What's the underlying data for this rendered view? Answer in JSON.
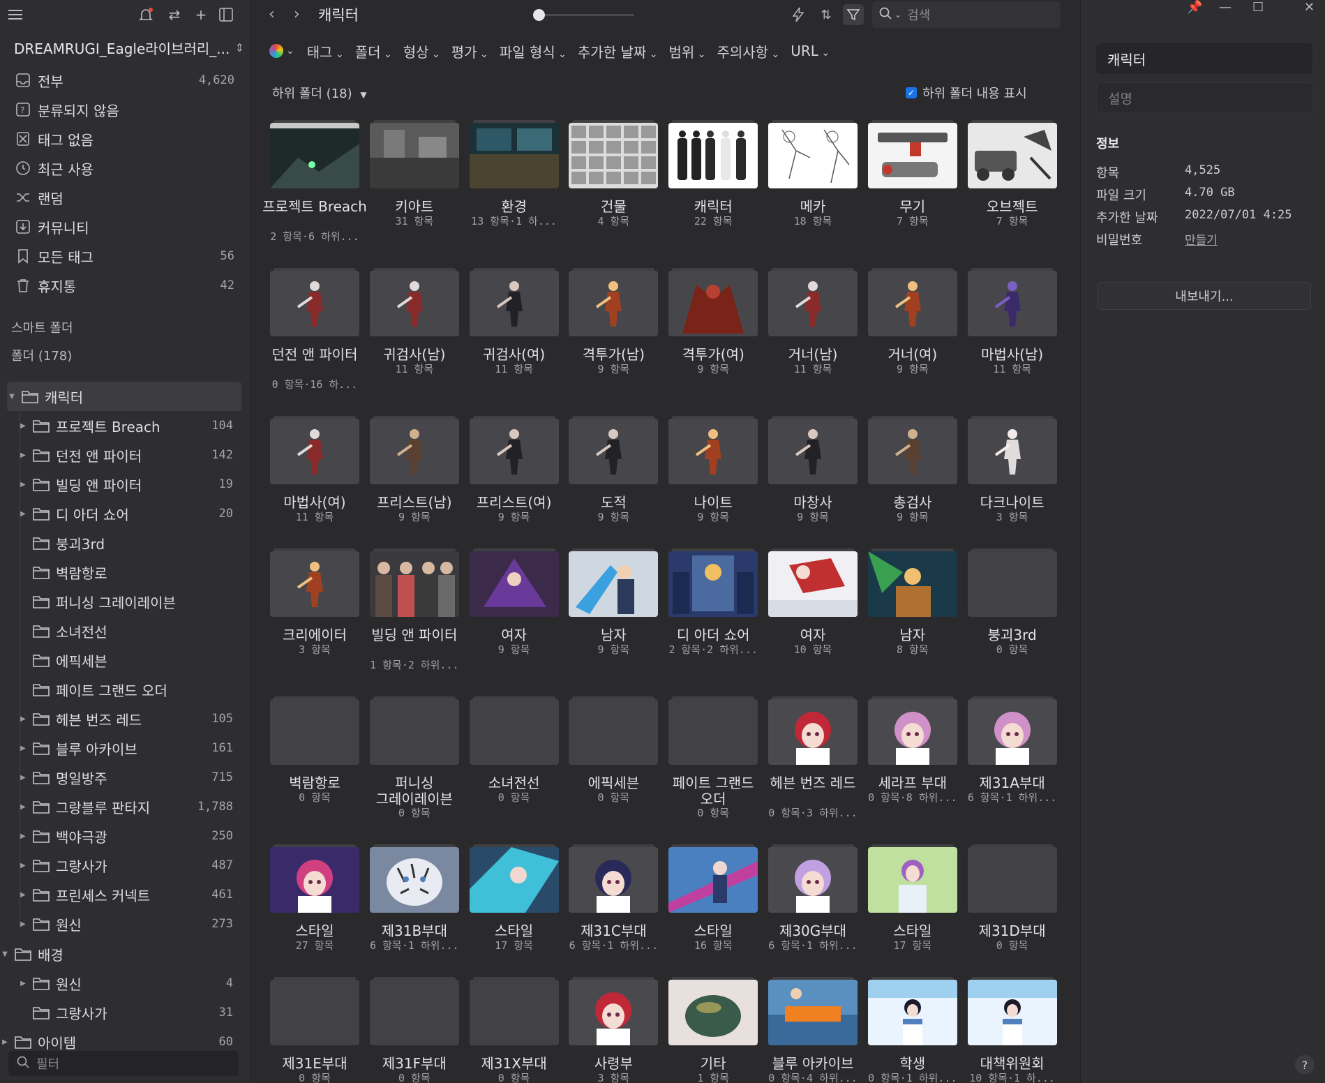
{
  "library": {
    "name": "DREAMRUGI_Eagle라이브러리_..."
  },
  "nav": [
    {
      "label": "전부",
      "count": "4,620",
      "icon": "inbox-icon"
    },
    {
      "label": "분류되지 않음",
      "count": "",
      "icon": "unsorted-icon"
    },
    {
      "label": "태그 없음",
      "count": "",
      "icon": "untagged-icon"
    },
    {
      "label": "최근 사용",
      "count": "",
      "icon": "clock-icon"
    },
    {
      "label": "랜덤",
      "count": "",
      "icon": "shuffle-icon"
    },
    {
      "label": "커뮤니티",
      "count": "",
      "icon": "download-icon"
    },
    {
      "label": "모든 태그",
      "count": "56",
      "icon": "bookmark-icon"
    },
    {
      "label": "휴지통",
      "count": "42",
      "icon": "trash-icon"
    }
  ],
  "sections": {
    "smart": "스마트 폴더",
    "folders": "폴더 (178)"
  },
  "tree": [
    {
      "label": "캐릭터",
      "count": "",
      "level": 0,
      "caret": "down",
      "selected": true
    },
    {
      "label": "프로젝트 Breach",
      "count": "104",
      "level": 1,
      "caret": "right"
    },
    {
      "label": "던전 앤 파이터",
      "count": "142",
      "level": 1,
      "caret": "right"
    },
    {
      "label": "빌딩 앤 파이터",
      "count": "19",
      "level": 1,
      "caret": "right"
    },
    {
      "label": "디 아더 쇼어",
      "count": "20",
      "level": 1,
      "caret": "right"
    },
    {
      "label": "붕괴3rd",
      "count": "",
      "level": 1,
      "caret": ""
    },
    {
      "label": "벽람항로",
      "count": "",
      "level": 1,
      "caret": ""
    },
    {
      "label": "퍼니싱 그레이레이븐",
      "count": "",
      "level": 1,
      "caret": ""
    },
    {
      "label": "소녀전선",
      "count": "",
      "level": 1,
      "caret": ""
    },
    {
      "label": "에픽세븐",
      "count": "",
      "level": 1,
      "caret": ""
    },
    {
      "label": "페이트 그랜드 오더",
      "count": "",
      "level": 1,
      "caret": ""
    },
    {
      "label": "헤븐 번즈 레드",
      "count": "105",
      "level": 1,
      "caret": "right"
    },
    {
      "label": "블루 아카이브",
      "count": "161",
      "level": 1,
      "caret": "right"
    },
    {
      "label": "명일방주",
      "count": "715",
      "level": 1,
      "caret": "right"
    },
    {
      "label": "그랑블루 판타지",
      "count": "1,788",
      "level": 1,
      "caret": "right"
    },
    {
      "label": "백야극광",
      "count": "250",
      "level": 1,
      "caret": "right"
    },
    {
      "label": "그랑사가",
      "count": "487",
      "level": 1,
      "caret": "right"
    },
    {
      "label": "프린세스 커넥트",
      "count": "461",
      "level": 1,
      "caret": "right"
    },
    {
      "label": "원신",
      "count": "273",
      "level": 1,
      "caret": "right"
    },
    {
      "label": "배경",
      "count": "",
      "level": 0,
      "caret": "down"
    },
    {
      "label": "원신",
      "count": "4",
      "level": 1,
      "caret": "right"
    },
    {
      "label": "그랑사가",
      "count": "31",
      "level": 1,
      "caret": ""
    },
    {
      "label": "아이템",
      "count": "60",
      "level": 0,
      "caret": "right"
    }
  ],
  "filter_placeholder": "필터",
  "topbar": {
    "title": "캐릭터",
    "search_placeholder": "검색"
  },
  "filters": [
    "태그",
    "폴더",
    "형상",
    "평가",
    "파일 형식",
    "추가한 날짜",
    "범위",
    "주의사항",
    "URL"
  ],
  "subfolders": {
    "label": "하위 폴더 (18)",
    "show_label": "하위 폴더 내용 표시"
  },
  "cards": [
    {
      "name": "프로젝트 Breach",
      "meta": "2 항목·6 하위...",
      "thumb": "screen"
    },
    {
      "name": "키아트",
      "meta": "31 항목",
      "thumb": "gray"
    },
    {
      "name": "환경",
      "meta": "13 항목·1 하...",
      "thumb": "teal"
    },
    {
      "name": "건물",
      "meta": "4 항목",
      "thumb": "sketch"
    },
    {
      "name": "캐릭터",
      "meta": "22 항목",
      "thumb": "white-chars"
    },
    {
      "name": "메카",
      "meta": "18 항목",
      "thumb": "lineart"
    },
    {
      "name": "무기",
      "meta": "7 항목",
      "thumb": "weapon"
    },
    {
      "name": "오브젝트",
      "meta": "7 항목",
      "thumb": "objects"
    },
    {
      "name": "던전 앤 파이터",
      "meta": "0 항목·16 하...",
      "thumb": "char-red"
    },
    {
      "name": "귀검사(남)",
      "meta": "11 항목",
      "thumb": "char-red"
    },
    {
      "name": "귀검사(여)",
      "meta": "11 항목",
      "thumb": "char-dark"
    },
    {
      "name": "격투가(남)",
      "meta": "9 항목",
      "thumb": "char-orange"
    },
    {
      "name": "격투가(여)",
      "meta": "9 항목",
      "thumb": "char-crimson"
    },
    {
      "name": "거너(남)",
      "meta": "11 항목",
      "thumb": "char-red"
    },
    {
      "name": "거너(여)",
      "meta": "9 항목",
      "thumb": "char-orange"
    },
    {
      "name": "마법사(남)",
      "meta": "11 항목",
      "thumb": "char-purple"
    },
    {
      "name": "마법사(여)",
      "meta": "11 항목",
      "thumb": "char-red"
    },
    {
      "name": "프리스트(남)",
      "meta": "9 항목",
      "thumb": "char-brown"
    },
    {
      "name": "프리스트(여)",
      "meta": "9 항목",
      "thumb": "char-dark"
    },
    {
      "name": "도적",
      "meta": "9 항목",
      "thumb": "char-dark"
    },
    {
      "name": "나이트",
      "meta": "9 항목",
      "thumb": "char-orange"
    },
    {
      "name": "마창사",
      "meta": "9 항목",
      "thumb": "char-dark"
    },
    {
      "name": "총검사",
      "meta": "9 항목",
      "thumb": "char-brown"
    },
    {
      "name": "다크나이트",
      "meta": "3 항목",
      "thumb": "char-white"
    },
    {
      "name": "크리에이터",
      "meta": "3 항목",
      "thumb": "char-orange"
    },
    {
      "name": "빌딩 앤 파이터",
      "meta": "1 항목·2 하위...",
      "thumb": "group"
    },
    {
      "name": "여자",
      "meta": "9 항목",
      "thumb": "purple-art"
    },
    {
      "name": "남자",
      "meta": "9 항목",
      "thumb": "blue-art"
    },
    {
      "name": "디 아더 쇼어",
      "meta": "2 항목·2 하위...",
      "thumb": "card-art"
    },
    {
      "name": "여자",
      "meta": "10 항목",
      "thumb": "red-white"
    },
    {
      "name": "남자",
      "meta": "8 항목",
      "thumb": "green-art"
    },
    {
      "name": "붕괴3rd",
      "meta": "0 항목",
      "thumb": "empty"
    },
    {
      "name": "벽람항로",
      "meta": "0 항목",
      "thumb": "empty"
    },
    {
      "name": "퍼니싱 그레이레이븐",
      "meta": "0 항목",
      "thumb": "empty"
    },
    {
      "name": "소녀전선",
      "meta": "0 항목",
      "thumb": "empty"
    },
    {
      "name": "에픽세븐",
      "meta": "0 항목",
      "thumb": "empty"
    },
    {
      "name": "페이트 그랜드 오더",
      "meta": "0 항목",
      "thumb": "empty"
    },
    {
      "name": "헤븐 번즈 레드",
      "meta": "0 항목·3 하위...",
      "thumb": "anime-red"
    },
    {
      "name": "세라프 부대",
      "meta": "0 항목·8 하위...",
      "thumb": "anime-pink"
    },
    {
      "name": "제31A부대",
      "meta": "6 항목·1 하위...",
      "thumb": "anime-pink"
    },
    {
      "name": "스타일",
      "meta": "27 항목",
      "thumb": "anime-magenta"
    },
    {
      "name": "제31B부대",
      "meta": "6 항목·1 하위...",
      "thumb": "tiger"
    },
    {
      "name": "스타일",
      "meta": "17 항목",
      "thumb": "anime-cyan"
    },
    {
      "name": "제31C부대",
      "meta": "6 항목·1 하위...",
      "thumb": "anime-navy"
    },
    {
      "name": "스타일",
      "meta": "16 항목",
      "thumb": "anime-blue"
    },
    {
      "name": "제30G부대",
      "meta": "6 항목·1 하위...",
      "thumb": "anime-lilac"
    },
    {
      "name": "스타일",
      "meta": "17 항목",
      "thumb": "anime-green"
    },
    {
      "name": "제31D부대",
      "meta": "0 항목",
      "thumb": "empty"
    },
    {
      "name": "제31E부대",
      "meta": "0 항목",
      "thumb": "empty"
    },
    {
      "name": "제31F부대",
      "meta": "0 항목",
      "thumb": "empty"
    },
    {
      "name": "제31X부대",
      "meta": "0 항목",
      "thumb": "empty"
    },
    {
      "name": "사령부",
      "meta": "3 항목",
      "thumb": "anime-red"
    },
    {
      "name": "기타",
      "meta": "1 항목",
      "thumb": "slime"
    },
    {
      "name": "블루 아카이브",
      "meta": "0 항목·4 하위...",
      "thumb": "banner-orange"
    },
    {
      "name": "학생",
      "meta": "0 항목·1 하위...",
      "thumb": "banner-blue"
    },
    {
      "name": "대책위원회",
      "meta": "10 항목·1 하...",
      "thumb": "banner-blue"
    }
  ],
  "panel": {
    "name_value": "캐릭터",
    "desc_placeholder": "설명",
    "info_title": "정보",
    "info": [
      {
        "k": "항목",
        "v": "4,525"
      },
      {
        "k": "파일 크기",
        "v": "4.70 GB"
      },
      {
        "k": "추가한 날짜",
        "v": "2022/07/01 4:25"
      },
      {
        "k": "비밀번호",
        "v": "만들기"
      }
    ],
    "export": "내보내기..."
  },
  "colors": {
    "accent": "#1a73e8",
    "notify": "#e74c3c"
  }
}
